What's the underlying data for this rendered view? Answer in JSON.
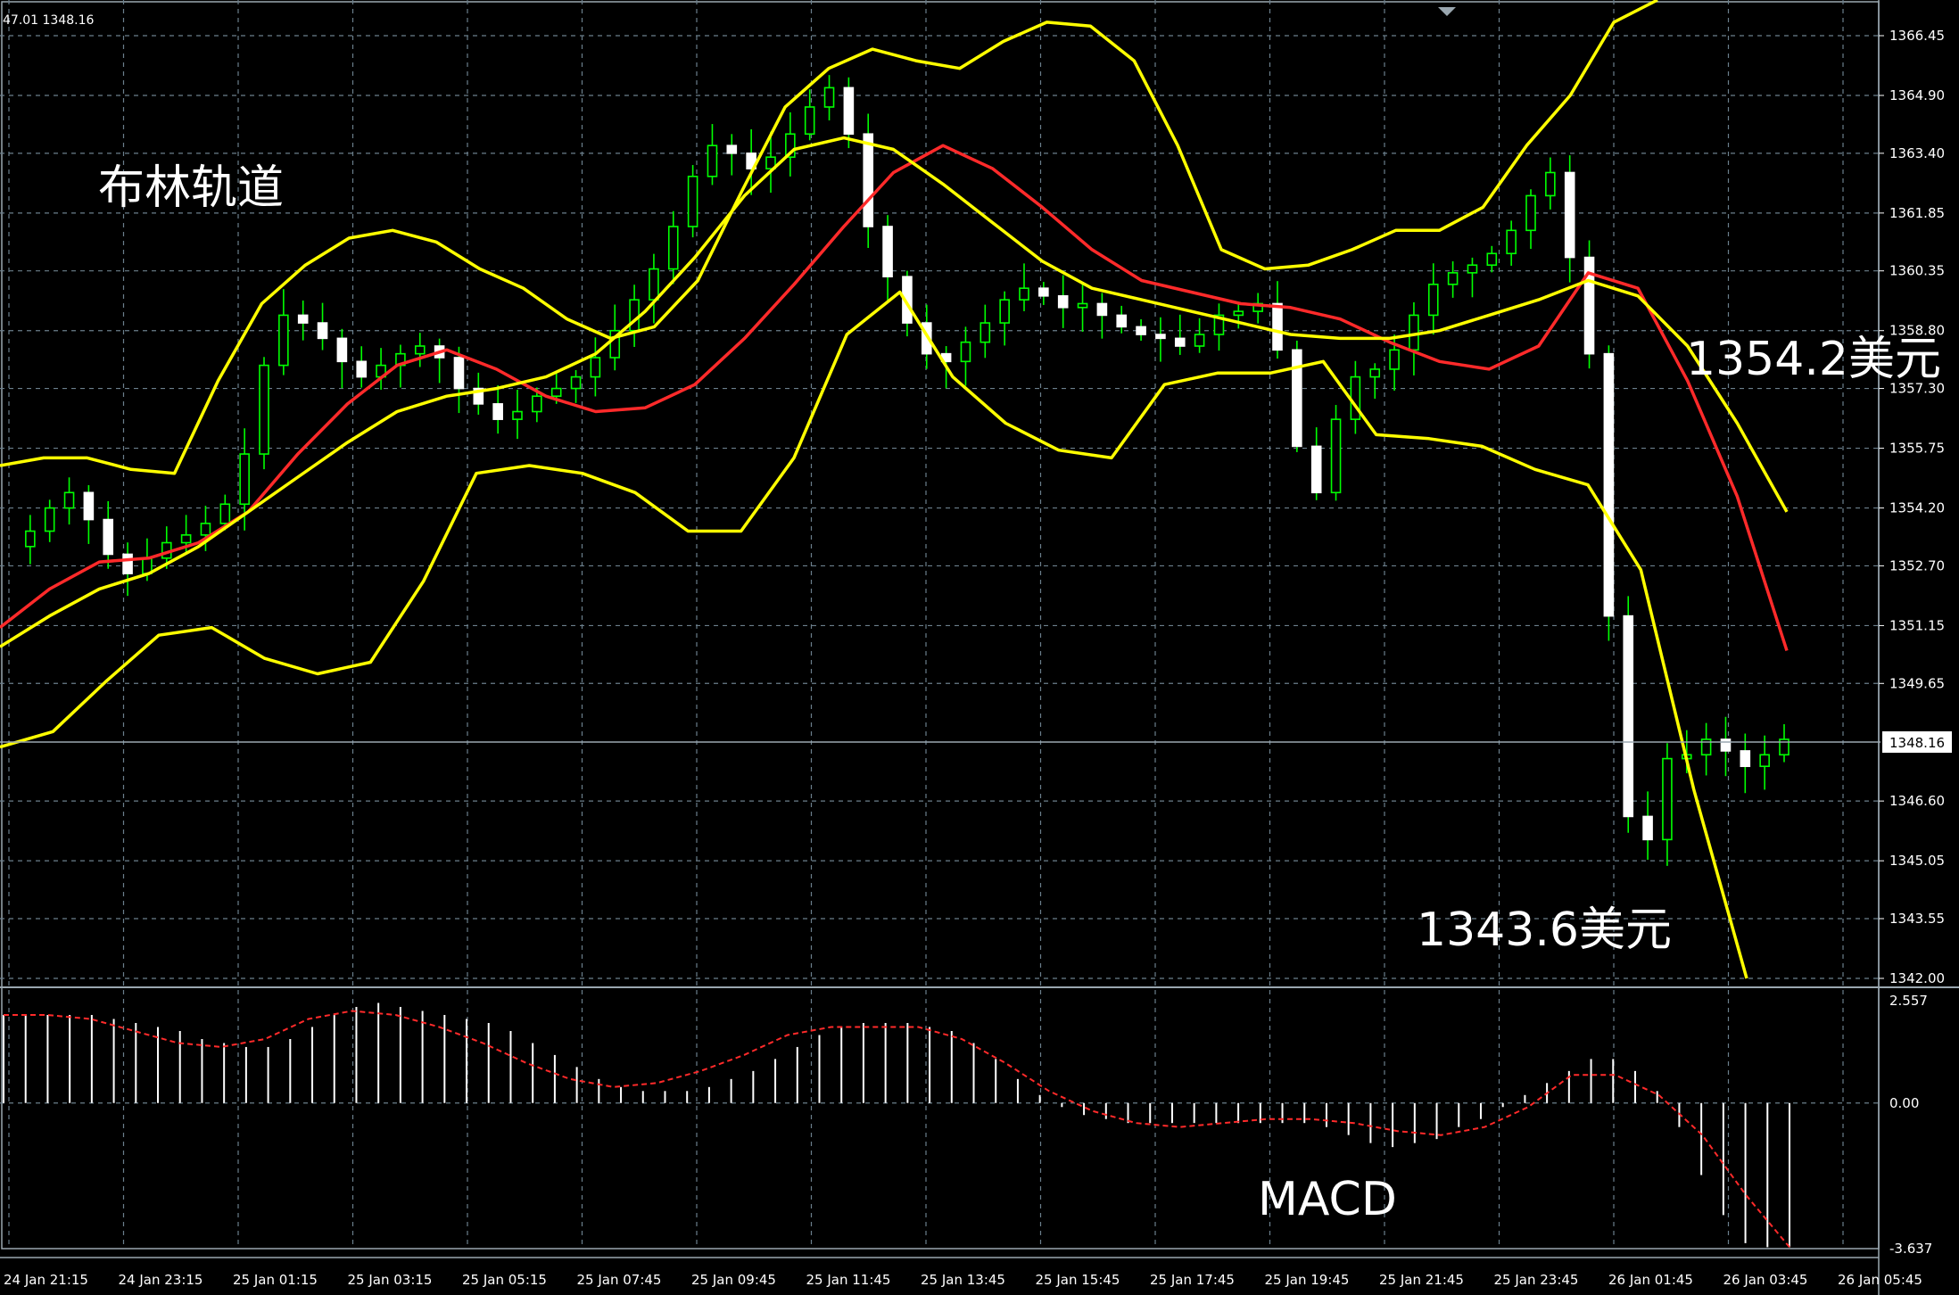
{
  "info_line": "47.01 1348.16",
  "current_price_label": "1348.16",
  "colors": {
    "background": "#000000",
    "grid": "#6b7f8c",
    "bull_candle": "#00ff00",
    "bear_candle": "#ffffff",
    "bollinger": "#ffff00",
    "moving_average": "#ff2a2a",
    "macd_histogram": "#ffffff",
    "macd_signal": "#ff2a2a",
    "text": "#ffffff"
  },
  "annotations": {
    "bollinger_label": "布林轨道",
    "upper_price_label": "1354.2美元",
    "lower_price_label": "1343.6美元",
    "macd_label": "MACD"
  },
  "chart_data": [
    {
      "type": "candlestick",
      "panel": "price",
      "y_ticks": [
        "1366.45",
        "1364.90",
        "1363.40",
        "1361.85",
        "1360.35",
        "1358.80",
        "1357.30",
        "1355.75",
        "1354.20",
        "1352.70",
        "1351.15",
        "1349.65",
        "1346.60",
        "1345.05",
        "1343.55",
        "1342.00"
      ],
      "ylim": [
        1342.0,
        1366.45
      ],
      "current_price": 1348.16,
      "x_ticks": [
        "24 Jan 21:15",
        "24 Jan 23:15",
        "25 Jan 01:15",
        "25 Jan 03:15",
        "25 Jan 05:15",
        "25 Jan 07:45",
        "25 Jan 09:45",
        "25 Jan 11:45",
        "25 Jan 13:45",
        "25 Jan 15:45",
        "25 Jan 17:45",
        "25 Jan 19:45",
        "25 Jan 21:45",
        "25 Jan 23:45",
        "26 Jan 01:45",
        "26 Jan 03:45",
        "26 Jan 05:45"
      ],
      "series": [
        {
          "name": "candles",
          "ohlc_close_path": [
            1353.2,
            1353.6,
            1354.2,
            1354.6,
            1353.9,
            1353.0,
            1352.5,
            1352.9,
            1353.3,
            1353.5,
            1353.8,
            1354.3,
            1355.6,
            1357.9,
            1359.2,
            1359.0,
            1358.6,
            1358.0,
            1357.6,
            1357.9,
            1358.2,
            1358.4,
            1358.1,
            1357.3,
            1356.9,
            1356.5,
            1356.7,
            1357.1,
            1357.3,
            1357.6,
            1358.1,
            1358.8,
            1359.6,
            1360.4,
            1361.5,
            1362.8,
            1363.6,
            1363.4,
            1363.0,
            1363.3,
            1363.9,
            1364.6,
            1365.1,
            1363.9,
            1361.5,
            1360.2,
            1359.0,
            1358.2,
            1358.0,
            1358.5,
            1359.0,
            1359.6,
            1359.9,
            1359.7,
            1359.4,
            1359.5,
            1359.2,
            1358.9,
            1358.7,
            1358.6,
            1358.4,
            1358.7,
            1359.2,
            1359.3,
            1359.5,
            1358.3,
            1355.8,
            1354.6,
            1356.5,
            1357.6,
            1357.8,
            1358.3,
            1359.2,
            1360.0,
            1360.3,
            1360.5,
            1360.8,
            1361.4,
            1362.3,
            1362.9,
            1360.7,
            1358.2,
            1351.4,
            1346.2,
            1345.6,
            1347.7,
            1347.8,
            1348.2,
            1347.9,
            1347.5,
            1347.8,
            1348.2
          ]
        },
        {
          "name": "bollinger_upper",
          "values": [
            1355.3,
            1355.5,
            1355.5,
            1355.2,
            1355.1,
            1357.5,
            1359.5,
            1360.5,
            1361.2,
            1361.4,
            1361.1,
            1360.4,
            1359.9,
            1359.1,
            1358.6,
            1358.9,
            1360.1,
            1362.4,
            1364.6,
            1365.6,
            1366.1,
            1365.8,
            1365.6,
            1366.3,
            1366.8,
            1366.7,
            1365.8,
            1363.6,
            1360.9,
            1360.4,
            1360.5,
            1360.9,
            1361.4,
            1361.4,
            1362.0,
            1363.6,
            1364.9,
            1366.8,
            1369.0
          ]
        },
        {
          "name": "moving_average",
          "values": [
            1351.1,
            1352.1,
            1352.8,
            1352.9,
            1353.3,
            1354.1,
            1355.6,
            1356.9,
            1357.9,
            1358.3,
            1357.8,
            1357.1,
            1356.7,
            1356.8,
            1357.4,
            1358.6,
            1360.0,
            1361.5,
            1362.9,
            1363.6,
            1363.0,
            1362.0,
            1360.9,
            1360.1,
            1359.8,
            1359.5,
            1359.4,
            1359.1,
            1358.5,
            1358.0,
            1357.8,
            1358.4,
            1360.3,
            1359.9,
            1357.5,
            1354.5,
            1350.5
          ]
        },
        {
          "name": "bollinger_middle",
          "values": [
            1350.6,
            1351.4,
            1352.1,
            1352.5,
            1353.2,
            1354.1,
            1355.0,
            1355.9,
            1356.7,
            1357.1,
            1357.3,
            1357.6,
            1358.2,
            1359.3,
            1360.7,
            1362.3,
            1363.5,
            1363.8,
            1363.5,
            1362.6,
            1361.6,
            1360.6,
            1359.9,
            1359.6,
            1359.3,
            1359.0,
            1358.7,
            1358.6,
            1358.6,
            1358.8,
            1359.2,
            1359.6,
            1360.1,
            1359.7,
            1358.4,
            1356.4,
            1354.1
          ]
        },
        {
          "name": "bollinger_lower",
          "values": [
            1348.0,
            1348.4,
            1349.7,
            1350.9,
            1351.1,
            1350.3,
            1349.9,
            1350.2,
            1352.3,
            1355.1,
            1355.3,
            1355.1,
            1354.6,
            1353.6,
            1353.6,
            1355.5,
            1358.7,
            1359.8,
            1357.6,
            1356.4,
            1355.7,
            1355.5,
            1357.4,
            1357.7,
            1357.7,
            1358.0,
            1356.1,
            1356.0,
            1355.8,
            1355.2,
            1354.8,
            1352.6,
            1346.9,
            1342.0
          ]
        }
      ]
    },
    {
      "type": "bar",
      "panel": "macd",
      "y_ticks": [
        "2.557",
        "0.00",
        "-3.637"
      ],
      "ylim": [
        -3.637,
        2.557
      ],
      "series": [
        {
          "name": "histogram",
          "values": [
            2.2,
            2.2,
            2.2,
            2.2,
            2.2,
            2.1,
            2.0,
            1.9,
            1.8,
            1.6,
            1.5,
            1.4,
            1.4,
            1.6,
            1.9,
            2.2,
            2.4,
            2.5,
            2.4,
            2.3,
            2.2,
            2.1,
            2.0,
            1.8,
            1.5,
            1.2,
            0.9,
            0.6,
            0.4,
            0.3,
            0.3,
            0.3,
            0.4,
            0.6,
            0.8,
            1.1,
            1.4,
            1.7,
            1.9,
            2.0,
            2.0,
            2.0,
            1.9,
            1.8,
            1.5,
            1.1,
            0.6,
            0.2,
            -0.1,
            -0.3,
            -0.4,
            -0.5,
            -0.5,
            -0.5,
            -0.5,
            -0.5,
            -0.5,
            -0.5,
            -0.5,
            -0.5,
            -0.6,
            -0.8,
            -1.0,
            -1.1,
            -1.0,
            -0.9,
            -0.6,
            -0.4,
            -0.1,
            0.2,
            0.5,
            0.8,
            1.1,
            1.1,
            0.8,
            0.3,
            -0.6,
            -1.8,
            -2.8,
            -3.5,
            -3.6,
            -3.6
          ]
        },
        {
          "name": "signal",
          "values": [
            2.2,
            2.2,
            2.1,
            1.8,
            1.5,
            1.4,
            1.6,
            2.1,
            2.3,
            2.2,
            1.9,
            1.5,
            1.0,
            0.6,
            0.4,
            0.5,
            0.8,
            1.2,
            1.7,
            1.9,
            1.9,
            1.9,
            1.6,
            1.0,
            0.3,
            -0.2,
            -0.5,
            -0.6,
            -0.5,
            -0.4,
            -0.4,
            -0.5,
            -0.7,
            -0.8,
            -0.6,
            -0.1,
            0.7,
            0.7,
            0.2,
            -0.8,
            -2.3,
            -3.6
          ]
        }
      ]
    }
  ]
}
